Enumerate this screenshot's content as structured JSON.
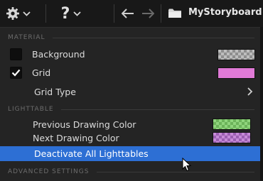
{
  "toolbar": {
    "settings_icon": "gear-icon",
    "help_label": "?",
    "back_icon": "arrow-left-icon",
    "forward_icon": "arrow-right-icon",
    "folder_icon": "folder-icon",
    "storyboard_title": "MyStoryboard",
    "unsaved_marker": "•"
  },
  "menu": {
    "section_material": "MATERIAL",
    "background_label": "Background",
    "grid_label": "Grid",
    "grid_type_label": "Grid Type",
    "section_lighttable": "LIGHTTABLE",
    "previous_color_label": "Previous Drawing Color",
    "next_color_label": "Next Drawing Color",
    "deactivate_label": "Deactivate All Lighttables",
    "section_advanced": "ADVANCED SETTINGS",
    "background_checked": false,
    "grid_checked": true
  },
  "colors": {
    "highlight": "#2d6fd4",
    "grid_swatch": "#e07ad6",
    "prev_color_swatch": "#7cc46a",
    "next_color_swatch": "#b36cc8",
    "background_swatch": "checkerboard-gray"
  }
}
